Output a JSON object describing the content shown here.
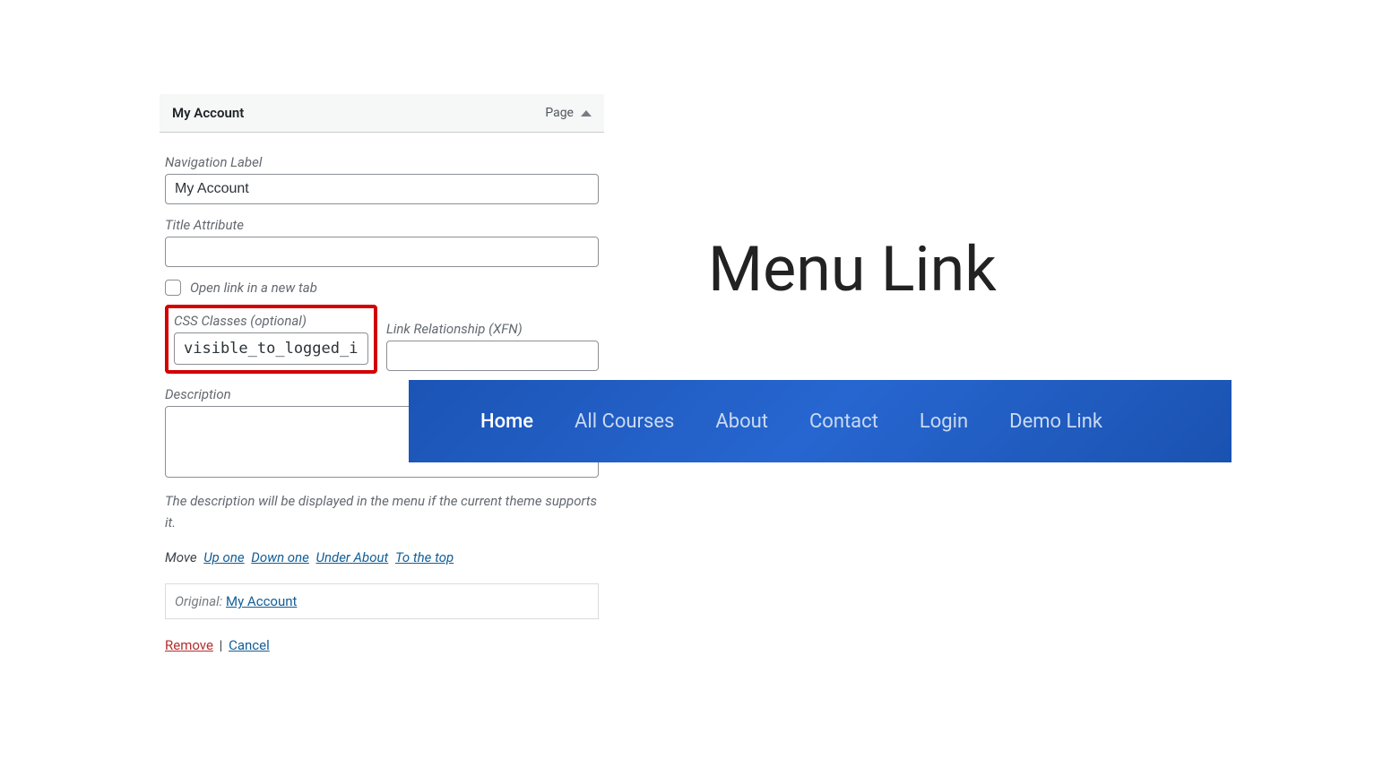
{
  "panel": {
    "headerTitle": "My Account",
    "headerType": "Page",
    "navigationLabel": {
      "label": "Navigation Label",
      "value": "My Account"
    },
    "titleAttribute": {
      "label": "Title Attribute",
      "value": ""
    },
    "openNewTab": {
      "label": "Open link in a new tab"
    },
    "cssClasses": {
      "label": "CSS Classes (optional)",
      "value": "visible_to_logged_in"
    },
    "linkRelationship": {
      "label": "Link Relationship (XFN)",
      "value": ""
    },
    "description": {
      "label": "Description",
      "value": ""
    },
    "descriptionNote": "The description will be displayed in the menu if the current theme supports it.",
    "move": {
      "label": "Move",
      "links": {
        "upOne": "Up one",
        "downOne": "Down one",
        "underAbout": "Under About",
        "toTop": "To the top"
      }
    },
    "original": {
      "label": "Original:",
      "link": "My Account"
    },
    "actions": {
      "remove": "Remove",
      "cancel": "Cancel"
    }
  },
  "bigTitle": "Menu Link",
  "nav": {
    "items": [
      {
        "label": "Home",
        "active": true
      },
      {
        "label": "All Courses",
        "active": false
      },
      {
        "label": "About",
        "active": false
      },
      {
        "label": "Contact",
        "active": false
      },
      {
        "label": "Login",
        "active": false
      },
      {
        "label": "Demo Link",
        "active": false
      }
    ]
  }
}
